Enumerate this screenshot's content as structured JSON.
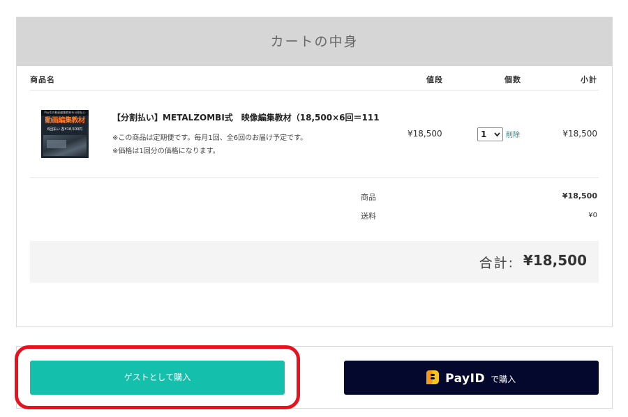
{
  "cart": {
    "title": "カートの中身",
    "columns": {
      "product": "商品名",
      "price": "値段",
      "quantity": "個数",
      "subtotal": "小計"
    },
    "items": [
      {
        "thumbnail": {
          "top_text": "PayIDの動画編集教材を分割払い",
          "title_text": "動画編集教材",
          "price_text": "6回払い 各¥18,500円"
        },
        "name": "【分割払い】METALZOMBI式　映像編集教材（18,500×6回＝111",
        "notes": [
          "※この商品は定期便です。毎月1回、全6回のお届け予定です。",
          "※価格は1回分の価格になります。"
        ],
        "price": "¥18,500",
        "quantity": "1",
        "delete_label": "削除",
        "subtotal": "¥18,500"
      }
    ],
    "summary": {
      "goods_label": "商品",
      "goods_value": "¥18,500",
      "shipping_label": "送料",
      "shipping_value": "¥0"
    },
    "total": {
      "label": "合計:",
      "value": "¥18,500"
    }
  },
  "actions": {
    "guest_label": "ゲストとして購入",
    "payid_logo": "PayID",
    "payid_suffix": "で購入"
  },
  "colors": {
    "guest_button": "#14bfab",
    "payid_button": "#05082d",
    "highlight": "#e8121f",
    "delete_link": "#1a8f8a"
  }
}
